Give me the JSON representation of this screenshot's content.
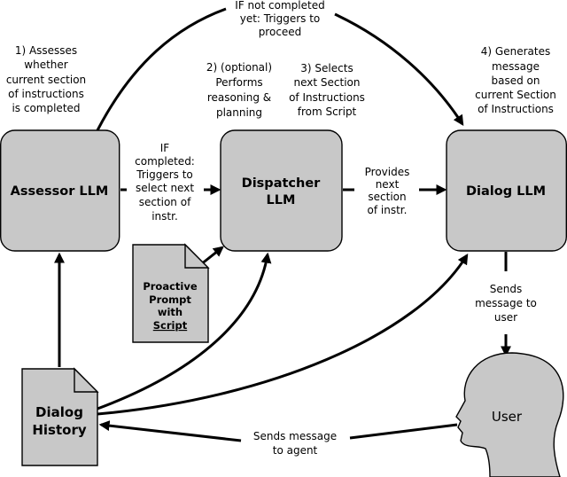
{
  "nodes": {
    "assessor": {
      "label": "Assessor LLM"
    },
    "dispatcher": {
      "label_lines": [
        "Dispatcher",
        "LLM"
      ]
    },
    "dialog_llm": {
      "label": "Dialog LLM"
    },
    "proactive_prompt": {
      "label_lines": [
        "Proactive",
        "Prompt",
        "with",
        "Script"
      ]
    },
    "dialog_history": {
      "label_lines": [
        "Dialog",
        "History"
      ]
    },
    "user": {
      "label": "User"
    }
  },
  "annotations": {
    "step1": [
      "1) Assesses",
      "whether",
      "current section",
      "of instructions",
      "is completed"
    ],
    "step2": [
      "2) (optional)",
      "Performs",
      "reasoning &",
      "planning"
    ],
    "step3": [
      "3) Selects",
      "next Section",
      "of Instructions",
      "from Script"
    ],
    "step4": [
      "4) Generates",
      "message",
      "based on",
      "current Section",
      "of Instructions"
    ]
  },
  "edges": {
    "not_completed": [
      "IF not completed",
      "yet: Triggers to",
      "proceed"
    ],
    "completed": [
      "IF",
      "completed:",
      "Triggers to",
      "select next",
      "section of",
      "instr."
    ],
    "provides": [
      "Provides",
      "next",
      "section",
      "of instr."
    ],
    "sends_to_user": [
      "Sends",
      "message to",
      "user"
    ],
    "sends_to_agent": [
      "Sends message",
      "to agent"
    ]
  },
  "colors": {
    "node_fill": "#c8c8c8",
    "stroke": "#000000"
  }
}
